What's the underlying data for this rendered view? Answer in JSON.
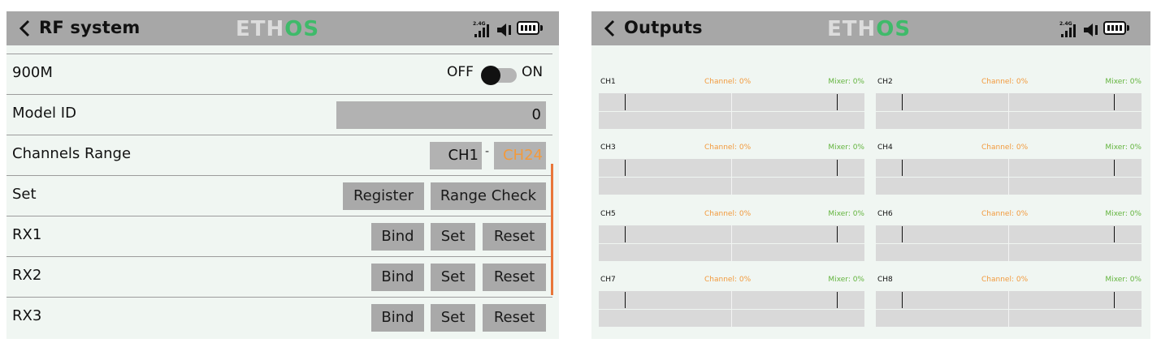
{
  "brand": {
    "logo_part1": "ETH",
    "logo_part2": "OS",
    "logo_color": "#3fba6a"
  },
  "status": {
    "signal_label": "2.4G",
    "icons": [
      "signal-icon",
      "speaker-icon",
      "battery-icon"
    ]
  },
  "left": {
    "title": "RF system",
    "rows": {
      "band": {
        "label": "900M",
        "off": "OFF",
        "on": "ON",
        "state": "off"
      },
      "model_id": {
        "label": "Model ID",
        "value": "0"
      },
      "channels_range": {
        "label": "Channels Range",
        "start": "CH1",
        "sep": "-",
        "end": "CH24"
      },
      "set": {
        "label": "Set",
        "register": "Register",
        "range_check": "Range Check"
      },
      "rx1": {
        "label": "RX1",
        "bind": "Bind",
        "set": "Set",
        "reset": "Reset"
      },
      "rx2": {
        "label": "RX2",
        "bind": "Bind",
        "set": "Set",
        "reset": "Reset"
      },
      "rx3": {
        "label": "RX3",
        "bind": "Bind",
        "set": "Set",
        "reset": "Reset"
      }
    },
    "accent_color": "#e8763a"
  },
  "right": {
    "title": "Outputs",
    "channels": [
      {
        "name": "CH1",
        "channel": "Channel: 0%",
        "mixer": "Mixer: 0%"
      },
      {
        "name": "CH2",
        "channel": "Channel: 0%",
        "mixer": "Mixer: 0%"
      },
      {
        "name": "CH3",
        "channel": "Channel: 0%",
        "mixer": "Mixer: 0%"
      },
      {
        "name": "CH4",
        "channel": "Channel: 0%",
        "mixer": "Mixer: 0%"
      },
      {
        "name": "CH5",
        "channel": "Channel: 0%",
        "mixer": "Mixer: 0%"
      },
      {
        "name": "CH6",
        "channel": "Channel: 0%",
        "mixer": "Mixer: 0%"
      },
      {
        "name": "CH7",
        "channel": "Channel: 0%",
        "mixer": "Mixer: 0%"
      },
      {
        "name": "CH8",
        "channel": "Channel: 0%",
        "mixer": "Mixer: 0%"
      }
    ],
    "channel_color": "#f29a3d",
    "mixer_color": "#63b43e"
  }
}
